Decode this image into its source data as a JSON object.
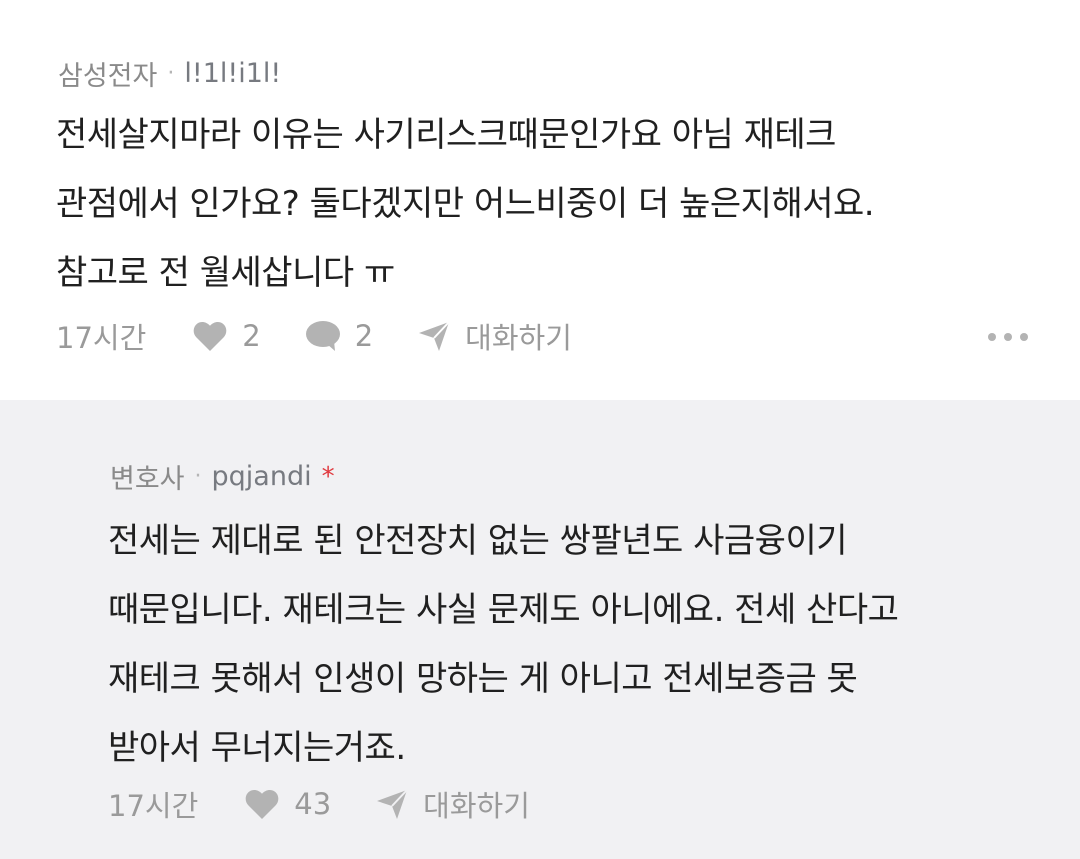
{
  "comments": [
    {
      "company": "삼성전자",
      "separator": "·",
      "nickname": "l!1l!i1l!",
      "body": "전세살지마라 이유는 사기리스크때문인가요 아님 재테크\n관점에서 인가요? 둘다겠지만 어느비중이 더 높은지해서요.\n참고로 전 월세삽니다 ㅠ",
      "time": "17시간",
      "likes": "2",
      "replies": "2",
      "chat_label": "대화하기",
      "icons": [
        "heart-icon",
        "speech-bubble-icon",
        "paper-plane-icon",
        "more-icon"
      ]
    },
    {
      "company": "변호사",
      "separator": "·",
      "nickname": "pqjandi",
      "author_badge": "*",
      "body": "전세는 제대로 된 안전장치 없는 쌍팔년도 사금융이기\n때문입니다. 재테크는 사실 문제도 아니에요. 전세 산다고\n재테크 못해서 인생이 망하는 게 아니고 전세보증금 못\n받아서 무너지는거죠.",
      "time": "17시간",
      "likes": "43",
      "chat_label": "대화하기",
      "icons": [
        "heart-icon",
        "paper-plane-icon"
      ]
    }
  ],
  "colors": {
    "reply_background": "#f1f1f3",
    "badge_red": "#e0393e",
    "icon_gray": "#b3b3b3",
    "meta_gray": "#8a8a8a"
  }
}
